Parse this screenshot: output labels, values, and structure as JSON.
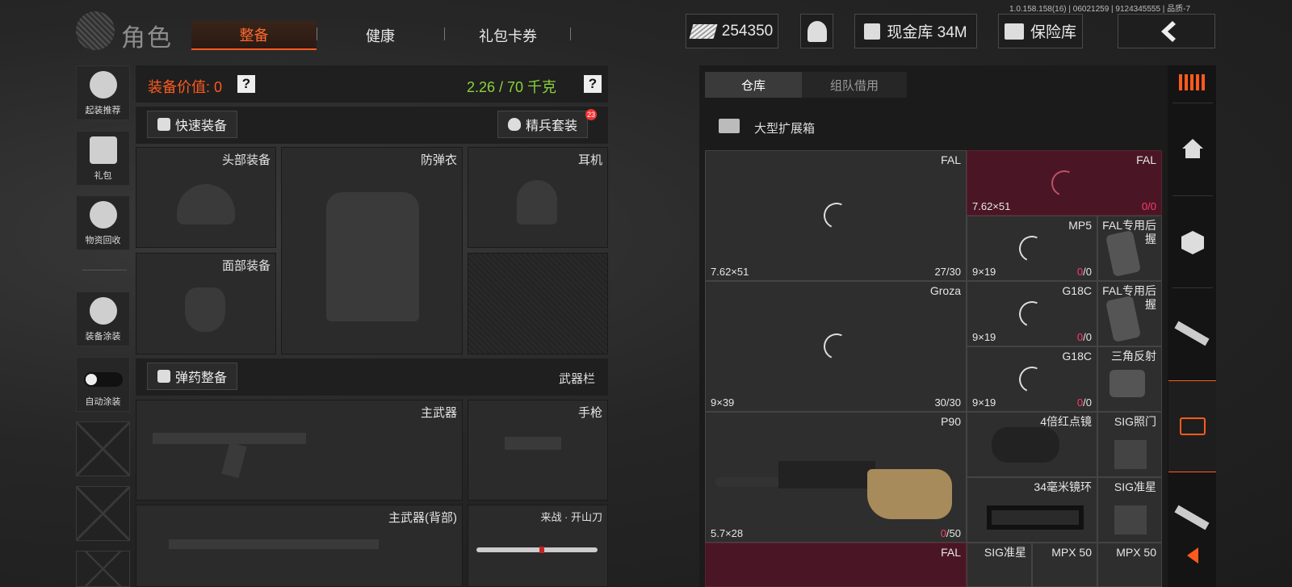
{
  "version": "1.0.158.158(16) | 06021259 | 9124345555 | 品质-7",
  "header": {
    "title": "角色",
    "tabs": [
      {
        "label": "整备",
        "active": true
      },
      {
        "label": "健康",
        "active": false
      },
      {
        "label": "礼包卡券",
        "active": false
      }
    ],
    "currency": "254350",
    "cash_stash": "现金库 34M",
    "safe": "保险库"
  },
  "left_menu": [
    {
      "label": "起装推荐",
      "icon": "helmet-gear-icon"
    },
    {
      "label": "礼包",
      "icon": "gift-icon"
    },
    {
      "label": "物资回收",
      "icon": "recycle-icon"
    },
    {
      "label": "装备涂装",
      "icon": "paint-helmet-icon"
    },
    {
      "label": "自动涂装",
      "icon": "toggle-icon"
    }
  ],
  "equipment": {
    "value_label": "装备价值: 0",
    "weight": "2.26 / 70 千克",
    "quick_equip": "快速装备",
    "elite_set": "精兵套装",
    "elite_badge": "23",
    "slots": {
      "head": "头部装备",
      "armor": "防弹衣",
      "headset": "耳机",
      "face": "面部装备"
    },
    "ammo_btn": "弹药整备",
    "weapon_bar": "武器栏",
    "weapons": {
      "primary": "主武器",
      "pistol": "手枪",
      "primary_back": "主武器(背部)",
      "melee": "来战 · 开山刀"
    }
  },
  "storage": {
    "tabs": [
      {
        "label": "仓库",
        "active": true
      },
      {
        "label": "组队借用",
        "active": false
      }
    ],
    "container": "大型扩展箱",
    "items": [
      {
        "name": "FAL",
        "caliber": "7.62×51",
        "count": "27/30",
        "style": "normal"
      },
      {
        "name": "FAL",
        "caliber": "7.62×51",
        "count_a": "0",
        "count_b": "/0",
        "style": "red"
      },
      {
        "name": "MP5",
        "caliber": "9×19",
        "count_a": "0",
        "count_b": "/0"
      },
      {
        "name": "FAL专用后握"
      },
      {
        "name": "Groza",
        "caliber": "9×39",
        "count": "30/30"
      },
      {
        "name": "G18C",
        "caliber": "9×19",
        "count_a": "0",
        "count_b": "/0"
      },
      {
        "name": "FAL专用后握"
      },
      {
        "name": "G18C",
        "caliber": "9×19",
        "count_a": "0",
        "count_b": "/0"
      },
      {
        "name": "三角反射"
      },
      {
        "name": "P90",
        "caliber": "5.7×28",
        "count_a": "0",
        "count_b": "/50"
      },
      {
        "name": "4倍红点镜"
      },
      {
        "name": "SIG照门"
      },
      {
        "name": "34毫米镜环"
      },
      {
        "name": "SIG准星"
      },
      {
        "name": "FAL",
        "style": "red"
      },
      {
        "name": "SIG准星"
      },
      {
        "name": "MPX 50"
      },
      {
        "name": "MPX 50"
      }
    ]
  }
}
